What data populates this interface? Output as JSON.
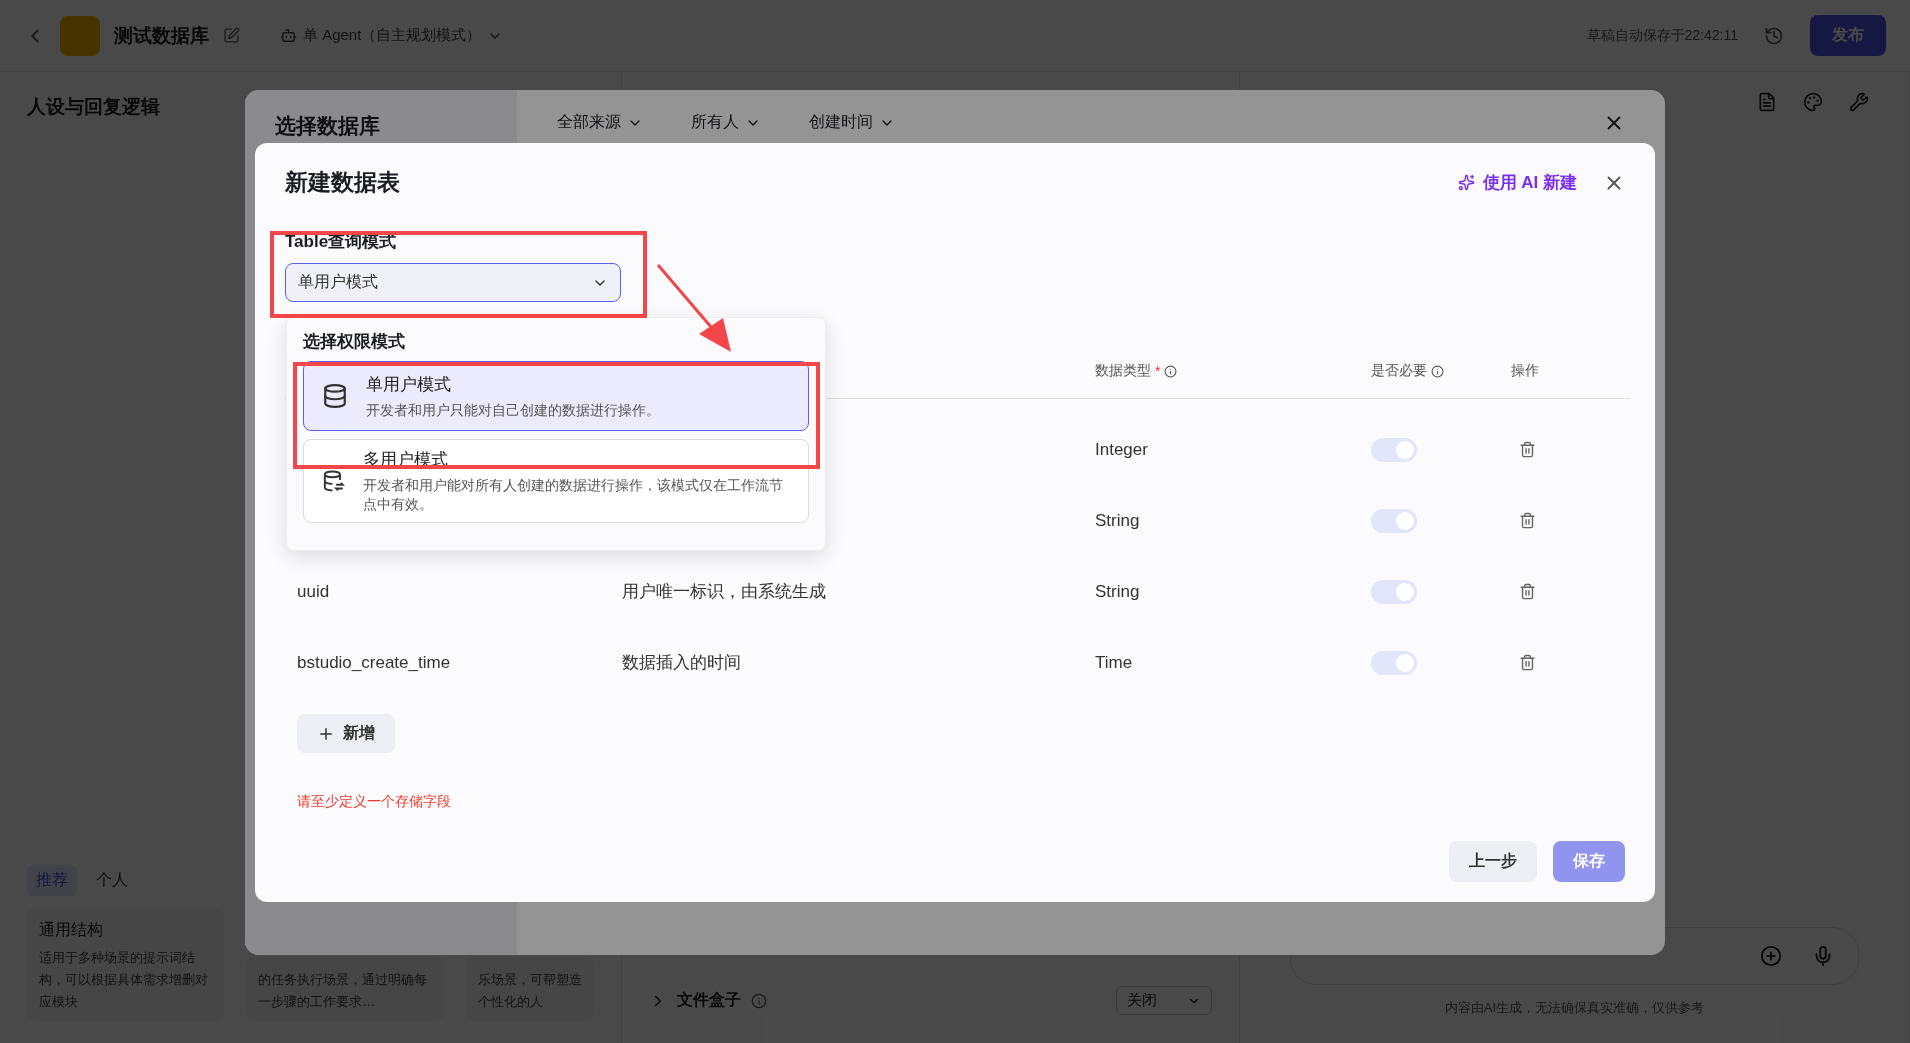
{
  "app": {
    "title": "测试数据库",
    "mode": "单 Agent（自主规划模式）",
    "autosave": "草稿自动保存于22:42:11",
    "publish": "发布",
    "section_title": "人设与回复逻辑",
    "prompt_tabs": [
      {
        "label": "推荐",
        "selected": true
      },
      {
        "label": "个人",
        "selected": false
      }
    ],
    "templates": [
      {
        "title": "通用结构",
        "description": "适用于多种场景的提示词结构，可以根据具体需求增删对应模块"
      },
      {
        "description": "的任务执行场景，通过明确每一步骤的工作要求…"
      },
      {
        "description": "乐场景，可帮塑造个性化的人"
      }
    ],
    "file_box": {
      "label": "文件盒子",
      "value": "关闭"
    },
    "chat_disclaimer": "内容由AI生成，无法确保真实准确，仅供参考"
  },
  "database_dialog": {
    "title": "选择数据库",
    "filters": [
      "全部来源",
      "所有人",
      "创建时间"
    ]
  },
  "table_dialog": {
    "title": "新建数据表",
    "ai_button": "使用 AI 新建",
    "query_mode": {
      "label": "Table查询模式",
      "value": "单用户模式"
    },
    "mode_menu": {
      "title": "选择权限模式",
      "options": [
        {
          "kind": "single",
          "title": "单用户模式",
          "description": "开发者和用户只能对自己创建的数据进行操作。",
          "selected": true
        },
        {
          "kind": "multi",
          "title": "多用户模式",
          "description": "开发者和用户能对所有人创建的数据进行操作，该模式仅在工作流节点中有效。",
          "selected": false
        }
      ]
    },
    "columns": [
      {
        "label": "数据类型",
        "required_mark": "*",
        "info": true
      },
      {
        "label": "是否必要",
        "info": true
      },
      {
        "label": "操作",
        "info": false
      }
    ],
    "rows": [
      {
        "type": "Integer",
        "required": true
      },
      {
        "type": "String",
        "required": true
      },
      {
        "name": "uuid",
        "description": "用户唯一标识，由系统生成",
        "type": "String",
        "required": true
      },
      {
        "name": "bstudio_create_time",
        "description": "数据插入的时间",
        "type": "Time",
        "required": true
      }
    ],
    "add_button": "新增",
    "error": "请至少定义一个存储字段",
    "back_button": "上一步",
    "save_button": {
      "label": "保存",
      "disabled": true
    }
  }
}
